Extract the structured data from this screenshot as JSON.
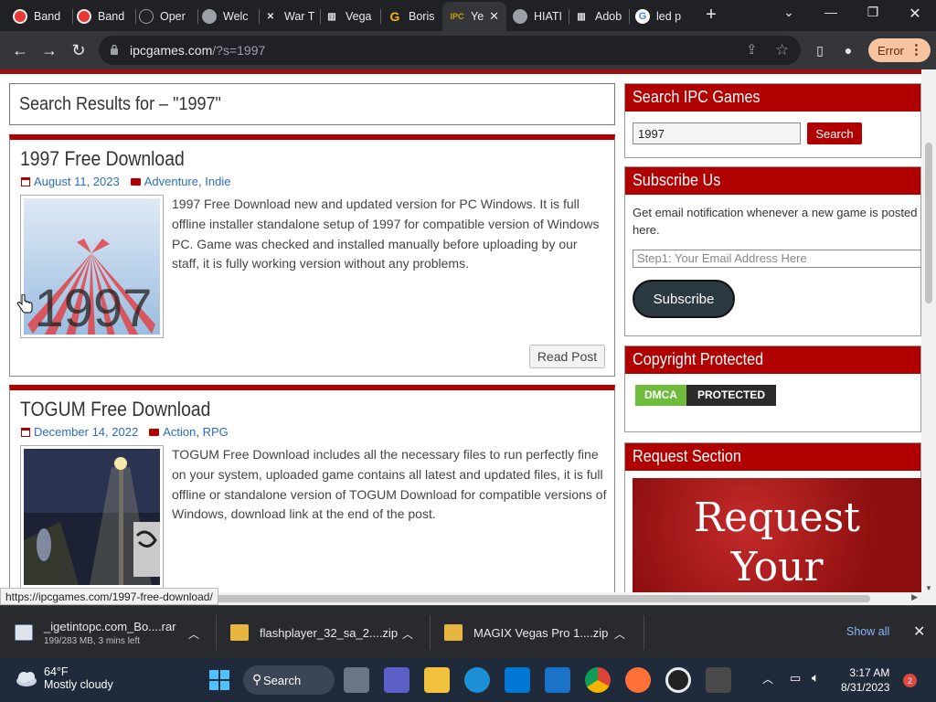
{
  "browser": {
    "tabs": [
      {
        "label": "Band",
        "icon": "record-icon",
        "color": "#e53935"
      },
      {
        "label": "Band",
        "icon": "record-icon",
        "color": "#e53935"
      },
      {
        "label": "Oper",
        "icon": "openai-icon",
        "color": "#9aa0a6"
      },
      {
        "label": "Welc",
        "icon": "globe-icon",
        "color": "#9aa0a6"
      },
      {
        "label": "War T",
        "icon": "wartable-icon",
        "color": "#9aa0a6"
      },
      {
        "label": "Vega",
        "icon": "museum-icon",
        "color": "#9aa0a6"
      },
      {
        "label": "Boris",
        "icon": "g-icon",
        "color": "#f4b400"
      },
      {
        "label": "Ye",
        "icon": "ipc-icon",
        "color": "#c8a000",
        "active": true
      },
      {
        "label": "HIATI",
        "icon": "globe-icon",
        "color": "#9aa0a6"
      },
      {
        "label": "Adob",
        "icon": "museum-icon",
        "color": "#9aa0a6"
      },
      {
        "label": "led p",
        "icon": "google-icon",
        "color": "#4285f4"
      }
    ],
    "new_tab": "+",
    "url_host": "ipcgames.com",
    "url_path": "/?s=1997",
    "error_label": "Error"
  },
  "page": {
    "search_heading": "Search Results for – \"1997\"",
    "posts": [
      {
        "title": "1997 Free Download",
        "date": "August 11, 2023",
        "cat1": "Adventure",
        "cat_sep": ",",
        "cat2": "Indie",
        "excerpt": "1997 Free Download new and updated version for PC Windows. It is full offline installer standalone setup of 1997 for compatible version of Windows PC. Game was checked and installed manually before uploading by our staff, it is fully working version without any problems.",
        "thumb_text": "1997",
        "read_label": "Read Post"
      },
      {
        "title": "TOGUM Free Download",
        "date": "December 14, 2022",
        "cat1": "Action",
        "cat_sep": ",",
        "cat2": "RPG",
        "excerpt": "TOGUM Free Download includes all the necessary files to run perfectly fine on your system, uploaded game contains all latest and updated files, it is full offline or standalone version of TOGUM Download for compatible versions of Windows, download link at the end of the post."
      }
    ]
  },
  "sidebar": {
    "search": {
      "title": "Search IPC Games",
      "value": "1997",
      "button": "Search"
    },
    "subscribe": {
      "title": "Subscribe Us",
      "text": "Get email notification whenever a new game is posted here.",
      "placeholder": "Step1: Your Email Address Here",
      "button": "Subscribe"
    },
    "copyright": {
      "title": "Copyright Protected",
      "badge_left": "DMCA",
      "badge_right": "PROTECTED"
    },
    "request": {
      "title": "Request Section",
      "line1": "Request",
      "line2": "Your"
    }
  },
  "status_url": "https://ipcgames.com/1997-free-download/",
  "downloads": {
    "items": [
      {
        "name": "_igetintopc.com_Bo....rar",
        "sub": "199/283 MB, 3 mins left"
      },
      {
        "name": "flashplayer_32_sa_2....zip"
      },
      {
        "name": "MAGIX Vegas Pro 1....zip"
      }
    ],
    "show_all": "Show all"
  },
  "taskbar": {
    "temp": "64°F",
    "weather": "Mostly cloudy",
    "search": "Search",
    "time": "3:17 AM",
    "date": "8/31/2023",
    "notifications": "2"
  }
}
